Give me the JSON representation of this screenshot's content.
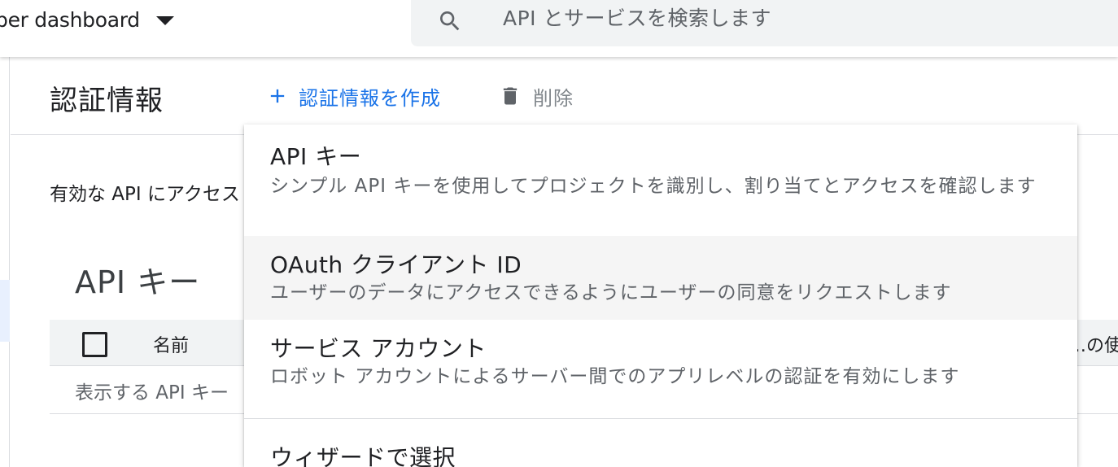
{
  "header": {
    "project_name": "per dashboard",
    "search": {
      "placeholder": "API とサービスを検索します"
    }
  },
  "toolbar": {
    "title": "認証情報",
    "create_label": "認証情報を作成",
    "delete_label": "削除"
  },
  "main": {
    "intro_text": "有効な API にアクセス",
    "api_keys": {
      "title": "API キー",
      "columns": [
        "名前",
        "…の使"
      ],
      "empty_text": "表示する API キー"
    }
  },
  "create_menu": {
    "items": [
      {
        "title": "API キー",
        "description": "シンプル API キーを使用してプロジェクトを識別し、割り当てとアクセスを確認します"
      },
      {
        "title": "OAuth クライアント ID",
        "description": "ユーザーのデータにアクセスできるようにユーザーの同意をリクエストします"
      },
      {
        "title": "サービス アカウント",
        "description": "ロボット アカウントによるサーバー間でのアプリレベルの認証を有効にします"
      },
      {
        "title": "ウィザードで選択",
        "description": ""
      }
    ]
  },
  "colors": {
    "accent": "#1a73e8",
    "text_primary": "#202124",
    "text_secondary": "#5f6368",
    "search_bg": "#f1f3f4",
    "menu_hover": "#f5f5f5"
  },
  "icons": [
    "dropdown-caret-icon",
    "search-icon",
    "plus-icon",
    "trash-icon",
    "checkbox-icon"
  ]
}
